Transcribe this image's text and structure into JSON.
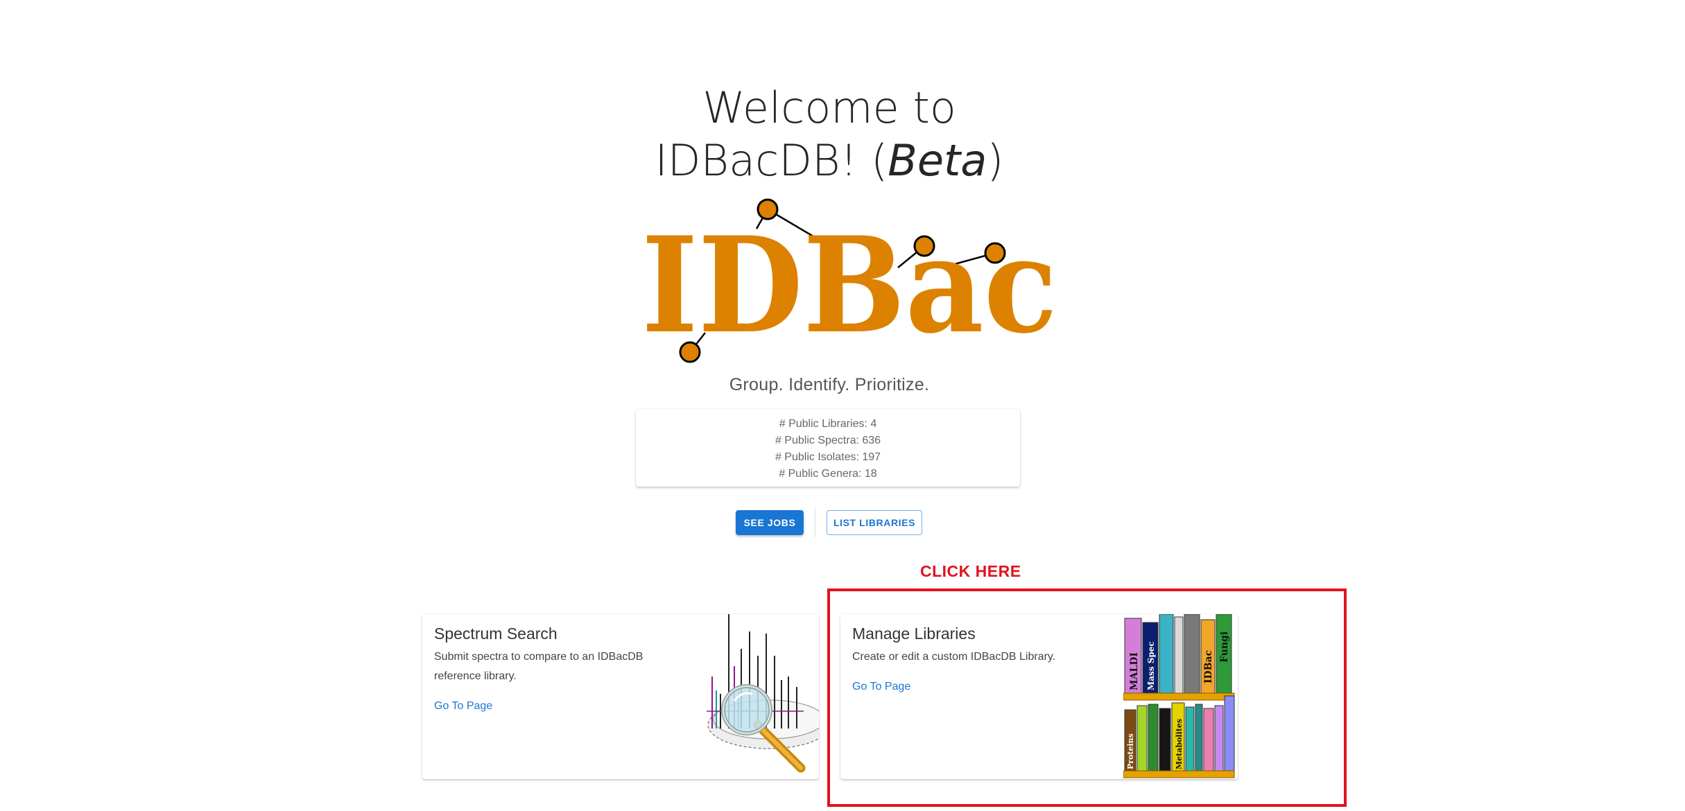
{
  "welcome": {
    "line1": "Welcome to",
    "line2_prefix": "IDBacDB! (",
    "line2_italic": "Beta",
    "line2_suffix": ")"
  },
  "logo": {
    "text": "IDBac",
    "color": "#dc8200"
  },
  "tagline": "Group. Identify. Prioritize.",
  "stats": {
    "public_libraries": "# Public Libraries: 4",
    "public_spectra": "# Public Spectra: 636",
    "public_isolates": "# Public Isolates: 197",
    "public_genera": "# Public Genera: 18"
  },
  "buttons": {
    "see_jobs": "SEE JOBS",
    "list_libraries": "LIST LIBRARIES"
  },
  "annotation": {
    "click_here": "CLICK HERE",
    "color": "#e0141e"
  },
  "cards": {
    "spectrum_search": {
      "title": "Spectrum Search",
      "desc_line1": "Submit spectra to compare to an IDBacDB",
      "desc_line2": "reference library.",
      "link": "Go To Page",
      "image_icon": "magnifier-over-spectrum-icon"
    },
    "manage_libraries": {
      "title": "Manage Libraries",
      "desc": "Create or edit a custom IDBacDB Library.",
      "link": "Go To Page",
      "image_icon": "bookshelf-icon",
      "book_labels": [
        "MALDI",
        "Mass Spec",
        "IDBac",
        "Fungi",
        "Proteins",
        "Metabolites"
      ]
    }
  },
  "colors": {
    "accent": "#1976d2"
  }
}
